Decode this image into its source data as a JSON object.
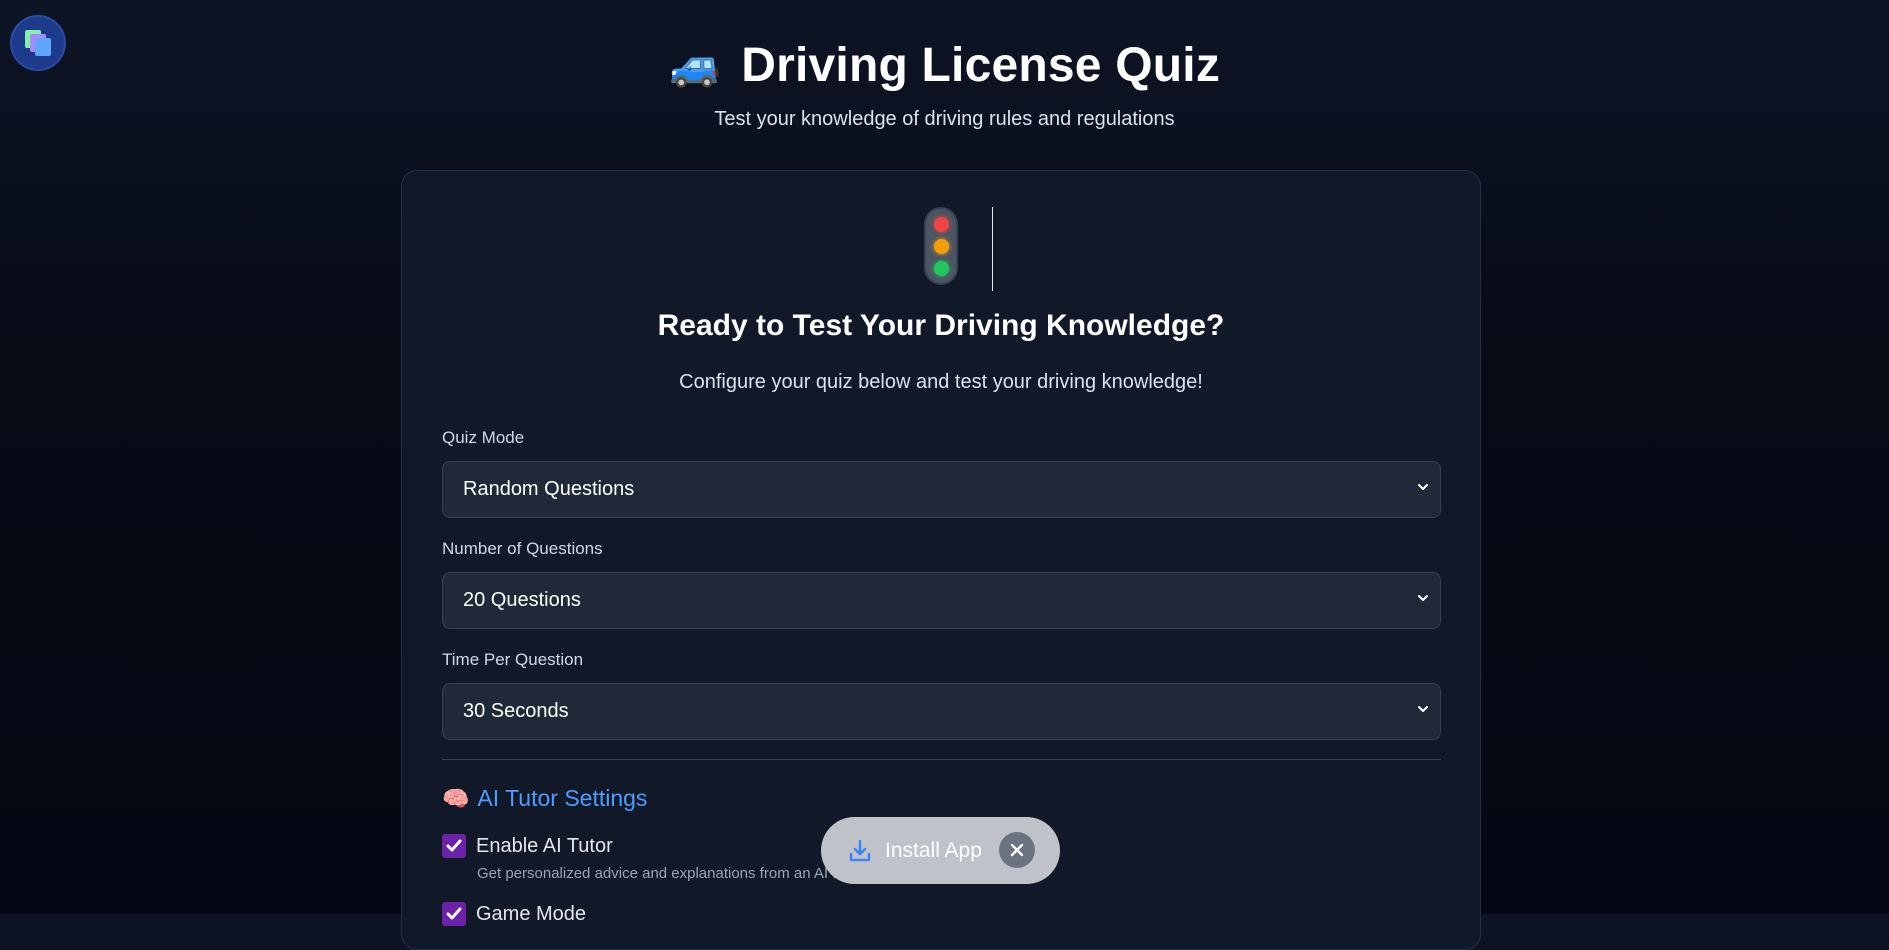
{
  "header": {
    "car_emoji": "🚙",
    "title": "Driving License Quiz",
    "subtitle": "Test your knowledge of driving rules and regulations"
  },
  "card": {
    "heading": "Ready to Test Your Driving Knowledge?",
    "intro": "Configure your quiz below and test your driving knowledge!",
    "fields": [
      {
        "label": "Quiz Mode",
        "value": "Random Questions"
      },
      {
        "label": "Number of Questions",
        "value": "20 Questions"
      },
      {
        "label": "Time Per Question",
        "value": "30 Seconds"
      }
    ],
    "ai_section": {
      "icon": "🧠",
      "title": "AI Tutor Settings",
      "options": [
        {
          "label": "Enable AI Tutor",
          "checked": true,
          "hint": "Get personalized advice and explanations from an AI tutor"
        },
        {
          "label": "Game Mode",
          "checked": true
        }
      ]
    }
  },
  "install_prompt": {
    "label": "Install App"
  },
  "colors": {
    "accent_blue": "#4f9cff",
    "checkbox_purple": "#6b21a8",
    "card_bg": "#111827",
    "select_bg": "#1f2937"
  },
  "icons": [
    "app-logo-icon",
    "car-icon",
    "traffic-light-icon",
    "brain-icon",
    "download-icon",
    "close-icon",
    "chevron-down-icon",
    "check-icon"
  ]
}
